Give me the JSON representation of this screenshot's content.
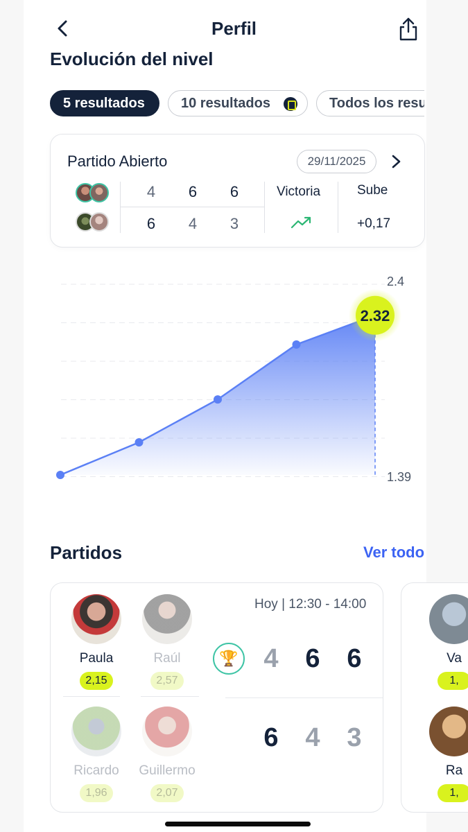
{
  "nav": {
    "title": "Perfil",
    "back_icon": "chevron-left-icon",
    "share_icon": "share-icon"
  },
  "level_section": {
    "title": "Evolución del nivel"
  },
  "tabs": [
    {
      "label": "5 resultados",
      "active": true
    },
    {
      "label": "10 resultados",
      "active": false,
      "badge_icon": "premium-icon"
    },
    {
      "label": "Todos los resultados",
      "active": false
    }
  ],
  "last_match": {
    "title": "Partido Abierto",
    "date": "29/11/2025",
    "team1_scores": [
      "4",
      "6",
      "6"
    ],
    "team2_scores": [
      "6",
      "4",
      "3"
    ],
    "result_label": "Victoria",
    "trend_label": "Sube",
    "delta": "+0,17",
    "trend_icon": "trend-up-icon",
    "trend_color": "#2bb673"
  },
  "chart_data": {
    "type": "area",
    "x": [
      1,
      2,
      3,
      4,
      5
    ],
    "values": [
      1.39,
      1.58,
      1.83,
      2.15,
      2.32
    ],
    "highlight_value": "2.32",
    "ylim": [
      1.39,
      2.4
    ],
    "ytick_labels": [
      "2.4",
      "1.39"
    ],
    "grid": true,
    "line_color": "#5b80f5",
    "highlight_color": "#d9f21e"
  },
  "matches_section": {
    "title": "Partidos",
    "see_all": "Ver todo"
  },
  "match_card": {
    "time": "Hoy | 12:30 - 14:00",
    "team1": [
      {
        "name": "Paula",
        "level": "2,15",
        "faded": false
      },
      {
        "name": "Raúl",
        "level": "2,57",
        "faded": true
      }
    ],
    "team2": [
      {
        "name": "Ricardo",
        "level": "1,96",
        "faded": true
      },
      {
        "name": "Guillermo",
        "level": "2,07",
        "faded": true
      }
    ],
    "team1_scores": [
      "4",
      "6",
      "6"
    ],
    "team2_scores": [
      "6",
      "4",
      "3"
    ],
    "winner_icon": "trophy-icon"
  },
  "next_card": {
    "top_player": {
      "name": "Va",
      "level": "1,"
    },
    "bottom_player": {
      "name": "Ra",
      "level": "1,"
    }
  }
}
